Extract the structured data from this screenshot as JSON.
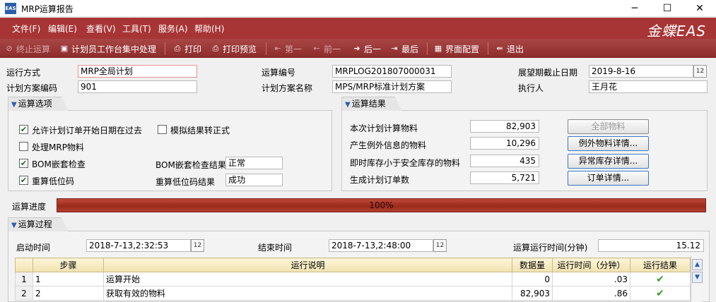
{
  "window": {
    "title": "MRP运算报告",
    "app_icon": "EAS"
  },
  "menu": {
    "items": [
      "文件(F)",
      "编辑(E)",
      "查看(V)",
      "工具(T)",
      "服务(A)",
      "帮助(H)"
    ],
    "logo": "金蝶EAS"
  },
  "toolbar": {
    "stop": "终止运算",
    "planner_workbench": "计划员工作台集中处理",
    "print": "打印",
    "print_preview": "打印预览",
    "first": "第一",
    "prev": "前一",
    "next": "后一",
    "last": "最后",
    "ui_config": "界面配置",
    "exit": "退出"
  },
  "header": {
    "run_mode_label": "运行方式",
    "run_mode": "MRP全局计划",
    "run_no_label": "运算编号",
    "run_no": "MRPLOG201807000031",
    "horizon_label": "展望期截止日期",
    "horizon": "2019-8-16",
    "plan_code_label": "计划方案编码",
    "plan_code": "901",
    "plan_name_label": "计划方案名称",
    "plan_name": "MPS/MRP标准计划方案",
    "executor_label": "执行人",
    "executor": "王月花"
  },
  "options": {
    "title": "运算选项",
    "allow_past": "允许计划订单开始日期在过去",
    "simulate": "模拟结果转正式",
    "handle_mrp": "处理MRP物料",
    "bom_check": "BOM嵌套检查",
    "bom_check_result_label": "BOM嵌套检查结果",
    "bom_check_result": "正常",
    "recalc_low": "重算低位码",
    "recalc_low_result_label": "重算低位码结果",
    "recalc_low_result": "成功"
  },
  "results": {
    "title": "运算结果",
    "calc_items_label": "本次计划计算物料",
    "calc_items": "82,903",
    "exception_label": "产生例外信息的物料",
    "exception": "10,296",
    "below_safety_label": "即时库存小于安全库存的物料",
    "below_safety": "435",
    "orders_label": "生成计划订单数",
    "orders": "5,721",
    "all_items_btn": "全部物料",
    "exception_btn": "例外物料详情...",
    "stock_btn": "异常库存详情...",
    "order_btn": "订单详情..."
  },
  "progress": {
    "label": "运算进度",
    "text": "100%",
    "value": 1.0
  },
  "process": {
    "title": "运算过程",
    "start_label": "启动时间",
    "start": "2018-7-13,2:32:53",
    "end_label": "结束时间",
    "end": "2018-7-13,2:48:00",
    "duration_label": "运算运行时间(分钟)",
    "duration": "15.12",
    "columns": [
      "步骤",
      "运行说明",
      "数据量",
      "运行时间（分钟）",
      "运行结果"
    ],
    "rows": [
      {
        "no": "1",
        "step": "1",
        "desc": "运算开始",
        "qty": "0",
        "time": ".03",
        "result": "✔"
      },
      {
        "no": "2",
        "step": "2",
        "desc": "获取有效的物料",
        "qty": "82,903",
        "time": ".86",
        "result": "✔"
      }
    ]
  },
  "colors": {
    "menubar": "#a83535",
    "toolbar": "#9a3535",
    "progress": "#b03a2a",
    "check": "#3a9a2a"
  }
}
